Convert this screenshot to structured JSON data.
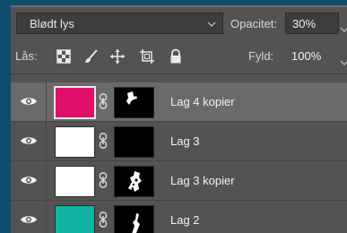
{
  "blend": {
    "mode": "Blødt lys",
    "opacity_label": "Opacitet:",
    "opacity_value": "30%"
  },
  "lock": {
    "label": "Lås:",
    "icons": [
      "lock-transparent-pixels-icon",
      "lock-image-pixels-icon",
      "lock-position-icon",
      "lock-artboard-icon",
      "lock-all-icon"
    ],
    "fill_label": "Fyld:",
    "fill_value": "100%"
  },
  "layers": [
    {
      "name": "Lag 4 kopier",
      "thumb_color": "#e0106a",
      "selected": true,
      "visible": true
    },
    {
      "name": "Lag 3",
      "thumb_color": "#ffffff",
      "selected": false,
      "visible": true
    },
    {
      "name": "Lag 3 kopier",
      "thumb_color": "#ffffff",
      "selected": false,
      "visible": true
    },
    {
      "name": "Lag 2",
      "thumb_color": "#12b3a6",
      "selected": false,
      "visible": true
    }
  ]
}
